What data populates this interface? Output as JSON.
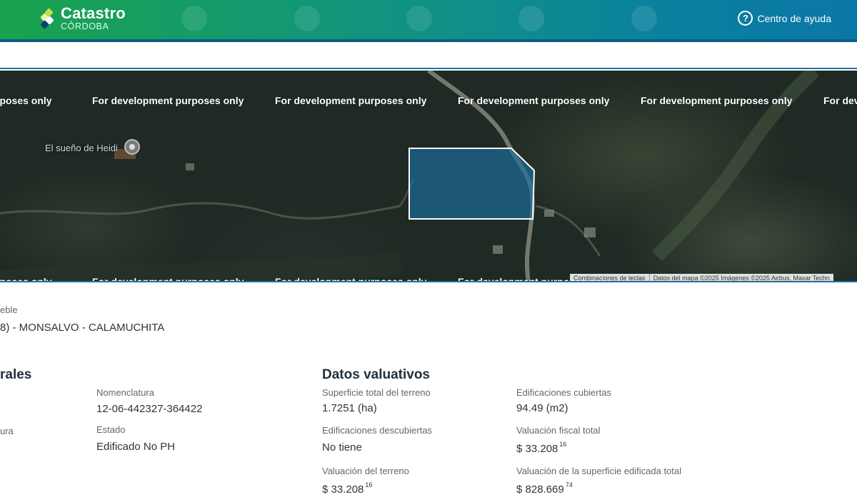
{
  "header": {
    "brand_title": "Catastro",
    "brand_subtitle": "CÓRDOBA",
    "help_label": "Centro de ayuda"
  },
  "map": {
    "watermark_text": "For development purposes only",
    "watermark_partial_left": "rposes only",
    "watermark_partial_right": "For dev",
    "poi_label": "El sueño de Heidi",
    "attribution_shortcuts": "Combinaciones de teclas",
    "attribution_data": "Datos del mapa ©2025 Imágenes ©2025 Airbus, Maxar Techn"
  },
  "property": {
    "type_label_partial": "eble",
    "location_partial": "8) - MONSALVO - CALAMUCHITA"
  },
  "cadastral": {
    "title_partial": "rales",
    "partial_label": "ura",
    "nomenclatura_label": "Nomenclatura",
    "nomenclatura_value": "12-06-442327-364422",
    "estado_label": "Estado",
    "estado_value": "Edificado No PH"
  },
  "valuation": {
    "title": "Datos valuativos",
    "superficie_label": "Superficie total del terreno",
    "superficie_value": "1.7251 (ha)",
    "edif_cubiertas_label": "Edificaciones cubiertas",
    "edif_cubiertas_value": "94.49 (m2)",
    "edif_descubiertas_label": "Edificaciones descubiertas",
    "edif_descubiertas_value": "No tiene",
    "valuacion_fiscal_label": "Valuación fiscal total",
    "valuacion_fiscal_main": "$ 33.208",
    "valuacion_fiscal_cents": "16",
    "valuacion_terreno_label": "Valuación del terreno",
    "valuacion_terreno_main": "$ 33.208",
    "valuacion_terreno_cents": "16",
    "valuacion_edificada_label": "Valuación de la superficie edificada total",
    "valuacion_edificada_main": "$ 828.669",
    "valuacion_edificada_cents": "74"
  },
  "colors": {
    "header_green": "#1aa24e",
    "header_blue": "#0a78a6",
    "parcel_fill": "#1a6ea0",
    "accent_line": "#1f6fa3"
  }
}
